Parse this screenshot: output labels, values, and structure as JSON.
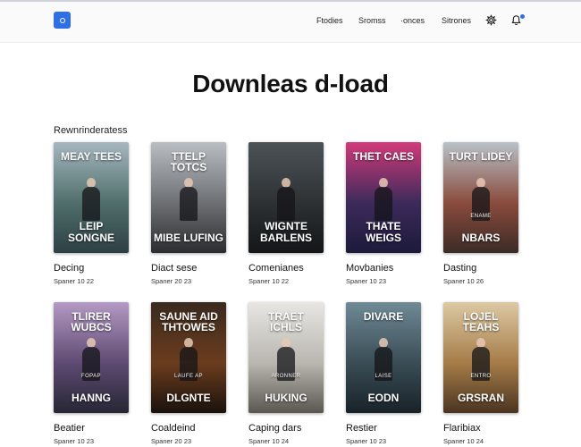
{
  "nav": {
    "links": [
      "Ftodies",
      "Sromss",
      "·onces",
      "Sitrones"
    ]
  },
  "page": {
    "title": "Downleas d-load",
    "section_title": "Rewnrinderatess"
  },
  "books": [
    {
      "title": "Decing",
      "meta": "Spaner 10 22",
      "cover_top": "MEAY TEES",
      "cover_bottom": "LEIP SONGNE",
      "cover_sub": "",
      "colors": [
        "#a6b7c0",
        "#4f6e6a",
        "#2d3f44"
      ]
    },
    {
      "title": "Diact sese",
      "meta": "Spaner 20 23",
      "cover_top": "TTELP TOTCS",
      "cover_bottom": "MIBE LUFING",
      "cover_sub": "",
      "colors": [
        "#b9bec2",
        "#6d6f73",
        "#2c2d31"
      ]
    },
    {
      "title": "Comenianes",
      "meta": "Spaner 10 22",
      "cover_top": "",
      "cover_bottom": "WIGNTE BARLENS",
      "cover_sub": "",
      "colors": [
        "#4c5357",
        "#2d3134",
        "#141618"
      ]
    },
    {
      "title": "Movbanies",
      "meta": "Spaner 10 23",
      "cover_top": "THET CAES",
      "cover_bottom": "THATE WEIGS",
      "cover_sub": "",
      "colors": [
        "#d23a7a",
        "#3c2a5a",
        "#1c1a3a"
      ]
    },
    {
      "title": "Dasting",
      "meta": "Spaner 10 26",
      "cover_top": "TURT LIDEY",
      "cover_bottom": "NBARS",
      "cover_sub": "ENAME",
      "colors": [
        "#b8c2c8",
        "#8a4b3c",
        "#3a2b26"
      ]
    },
    {
      "title": "Beatier",
      "meta": "Spaner 10 23",
      "cover_top": "TLIRER WUBCS",
      "cover_bottom": "HANNG",
      "cover_sub": "FOPAP",
      "colors": [
        "#b49ac4",
        "#5e4a72",
        "#262634"
      ]
    },
    {
      "title": "Coaldeind",
      "meta": "Spaner 20 23",
      "cover_top": "SAUNE AID THTOWES",
      "cover_bottom": "DLGNTE",
      "cover_sub": "LAUFE AP",
      "colors": [
        "#3a2a1e",
        "#6b3c1e",
        "#1a120c"
      ]
    },
    {
      "title": "Caping dars",
      "meta": "Spaner 10 24",
      "cover_top": "TRAET ICHLS",
      "cover_bottom": "HUKING",
      "cover_sub": "ARONNER",
      "colors": [
        "#e8e6e2",
        "#b9b6b0",
        "#5a5650"
      ]
    },
    {
      "title": "Restier",
      "meta": "Spaner 10 23",
      "cover_top": "DIVARE",
      "cover_bottom": "EODN",
      "cover_sub": "LAISE",
      "colors": [
        "#6f8a96",
        "#3a4c55",
        "#182228"
      ]
    },
    {
      "title": "Flaribiax",
      "meta": "Spaner 10 24",
      "cover_top": "LOJEL TEAHS",
      "cover_bottom": "GRSRAN",
      "cover_sub": "ENTRO",
      "colors": [
        "#dcc9a4",
        "#a67c48",
        "#4a3420"
      ]
    }
  ]
}
